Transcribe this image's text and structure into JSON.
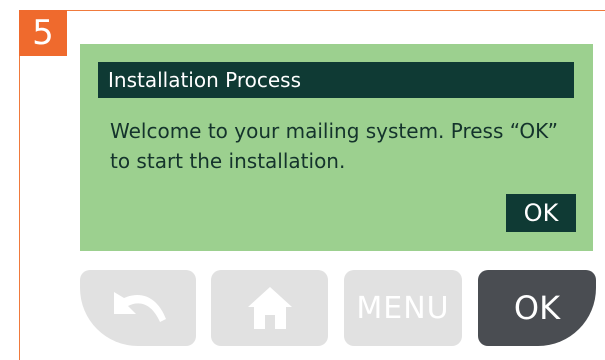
{
  "step": {
    "number": "5"
  },
  "screen": {
    "title": "Installation Process",
    "message": "Welcome to your mailing system. Press “OK” to start the installation.",
    "ok_label": "OK"
  },
  "buttons": {
    "back_icon": "back-arrow-icon",
    "home_icon": "home-icon",
    "menu_label": "MENU",
    "ok_label": "OK"
  },
  "colors": {
    "accent": "#ef6a2d",
    "screen_bg": "#9cd08f",
    "screen_dark": "#0f3a34",
    "button_gray": "#e1e1e1",
    "button_dark": "#4a4d52"
  }
}
